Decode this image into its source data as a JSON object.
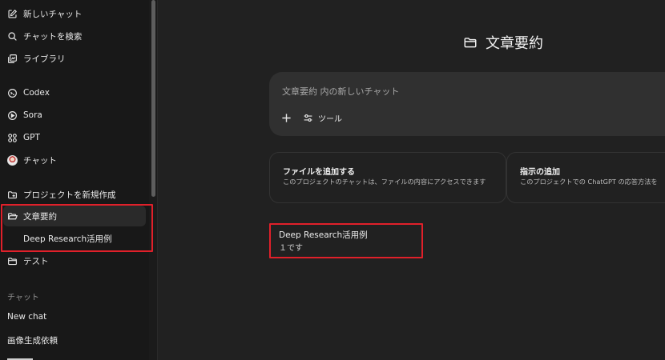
{
  "sidebar": {
    "top_items": [
      {
        "label": "新しいチャット",
        "icon": "new-chat-icon"
      },
      {
        "label": "チャットを検索",
        "icon": "search-icon"
      },
      {
        "label": "ライブラリ",
        "icon": "library-icon"
      }
    ],
    "app_items": [
      {
        "label": "Codex",
        "icon": "codex-icon"
      },
      {
        "label": "Sora",
        "icon": "sora-icon"
      },
      {
        "label": "GPT",
        "icon": "gpt-grid-icon"
      },
      {
        "label": "チャット",
        "icon": "avatar"
      }
    ],
    "projects": {
      "new_project_label": "プロジェクトを新規作成",
      "active_project": "文章要約",
      "active_project_chat": "Deep Research活用例",
      "other_project": "テスト"
    },
    "chats_section_label": "チャット",
    "chats": [
      "New chat",
      "画像生成依頼"
    ]
  },
  "main": {
    "project_title": "文章要約",
    "composer": {
      "placeholder": "文章要約 内の新しいチャット",
      "tools_label": "ツール"
    },
    "cards": [
      {
        "title": "ファイルを追加する",
        "desc": "このプロジェクトのチャットは、ファイルの内容にアクセスできます"
      },
      {
        "title": "指示の追加",
        "desc": "このプロジェクトでの ChatGPT の応答方法を"
      }
    ],
    "chat_entry": {
      "title": "Deep Research活用例",
      "snippet": "１です"
    }
  },
  "colors": {
    "highlight": "#e0202a",
    "background": "#212121",
    "sidebar": "#181818"
  }
}
